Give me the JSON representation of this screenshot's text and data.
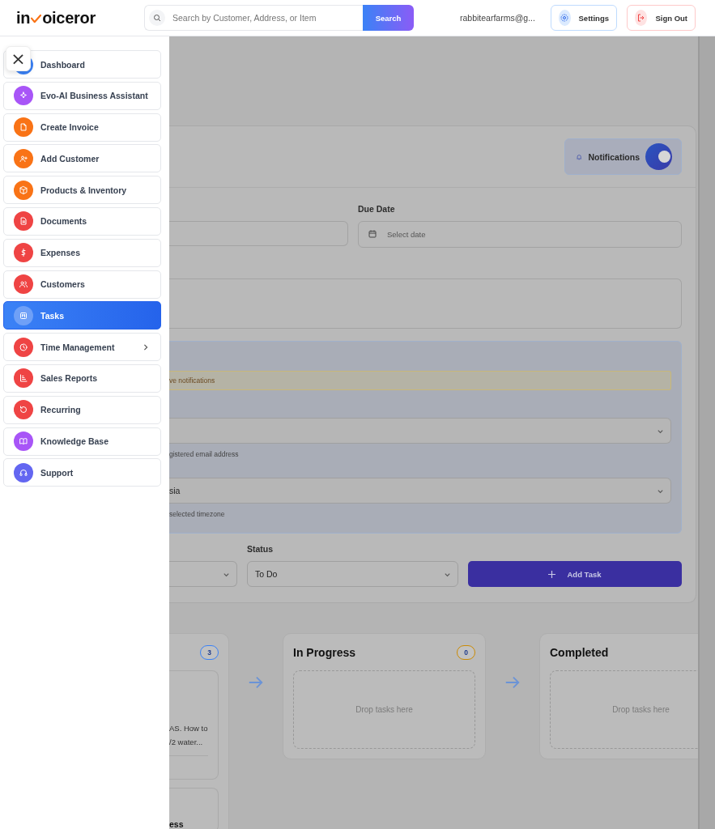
{
  "header": {
    "logo": {
      "prefix": "in",
      "suffix": "oiceror"
    },
    "search": {
      "placeholder": "Search by Customer, Address, or Item",
      "button": "Search"
    },
    "user_email": "rabbitearfarms@g...",
    "buttons": [
      {
        "label": "Settings",
        "kind": "settings"
      },
      {
        "label": "Sign Out",
        "kind": "signout"
      }
    ]
  },
  "sidebar": {
    "close": "×",
    "items": [
      {
        "label": "Dashboard",
        "color": "#3b82f6",
        "selected": false,
        "has_submenu": false
      },
      {
        "label": "Evo-AI Business Assistant",
        "color": "#a855f7",
        "selected": false,
        "has_submenu": false
      },
      {
        "label": "Create Invoice",
        "color": "#f97316",
        "selected": false,
        "has_submenu": false
      },
      {
        "label": "Add Customer",
        "color": "#f97316",
        "selected": false,
        "has_submenu": false
      },
      {
        "label": "Products & Inventory",
        "color": "#f97316",
        "selected": false,
        "has_submenu": false
      },
      {
        "label": "Documents",
        "color": "#ef4444",
        "selected": false,
        "has_submenu": false
      },
      {
        "label": "Expenses",
        "color": "#ef4444",
        "selected": false,
        "has_submenu": false
      },
      {
        "label": "Customers",
        "color": "#ef4444",
        "selected": false,
        "has_submenu": false
      },
      {
        "label": "Tasks",
        "color": "#6fa0f7",
        "selected": true,
        "has_submenu": false
      },
      {
        "label": "Time Management",
        "color": "#ef4444",
        "selected": false,
        "has_submenu": true
      },
      {
        "label": "Sales Reports",
        "color": "#ef4444",
        "selected": false,
        "has_submenu": false
      },
      {
        "label": "Recurring",
        "color": "#ef4444",
        "selected": false,
        "has_submenu": false
      },
      {
        "label": "Knowledge Base",
        "color": "#a855f7",
        "selected": false,
        "has_submenu": false
      },
      {
        "label": "Support",
        "color": "#6366f1",
        "selected": false,
        "has_submenu": false
      }
    ]
  },
  "form": {
    "notifications": {
      "label": "Notifications",
      "on": true
    },
    "due_date": {
      "label": "Due Date",
      "placeholder": "Select date"
    },
    "notice": "ve notifications",
    "email_hint": "gistered email address",
    "timezone": {
      "value": "sia",
      "hint": "selected timezone"
    },
    "status": {
      "label": "Status",
      "value": "To Do"
    },
    "add_button": "Add Task"
  },
  "kanban": {
    "columns": [
      {
        "count": "3",
        "color": "#3b82f6",
        "cards": [
          {
            "lines": [
              "AS. How to",
              "/2 water..."
            ]
          },
          {
            "lines": [
              "ess"
            ]
          }
        ]
      },
      {
        "title": "In Progress",
        "count": "0",
        "color": "#ca8a04",
        "drop_hint": "Drop tasks here"
      },
      {
        "title": "Completed",
        "drop_hint": "Drop tasks here"
      }
    ]
  }
}
